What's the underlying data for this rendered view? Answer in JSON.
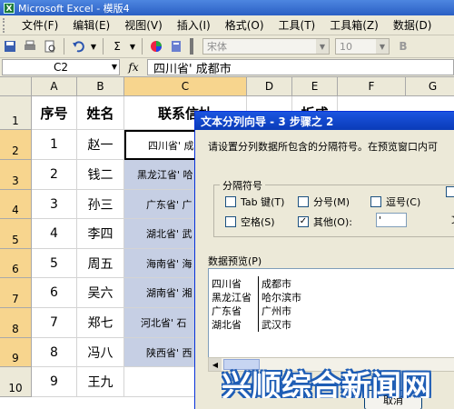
{
  "window": {
    "title": "Microsoft Excel - 模版4"
  },
  "menu": [
    {
      "label": "文件(F)"
    },
    {
      "label": "编辑(E)"
    },
    {
      "label": "视图(V)"
    },
    {
      "label": "插入(I)"
    },
    {
      "label": "格式(O)"
    },
    {
      "label": "工具(T)"
    },
    {
      "label": "工具箱(Z)"
    },
    {
      "label": "数据(D)"
    }
  ],
  "toolbar": {
    "font_name": "宋体",
    "font_size": "10",
    "sigma": "Σ"
  },
  "formula_bar": {
    "cell_ref": "C2",
    "fx": "fx",
    "content": "四川省' 成都市"
  },
  "columns": [
    "A",
    "B",
    "C",
    "D",
    "E",
    "F",
    "G"
  ],
  "rows": [
    "1",
    "2",
    "3",
    "4",
    "5",
    "6",
    "7",
    "8",
    "9",
    "10"
  ],
  "table": {
    "headers": [
      "序号",
      "姓名",
      "联系信址",
      "",
      "折成"
    ],
    "data": [
      {
        "no": "1",
        "name": "赵一",
        "addr": "四川省' 成"
      },
      {
        "no": "2",
        "name": "钱二",
        "addr": "黑龙江省' 哈"
      },
      {
        "no": "3",
        "name": "孙三",
        "addr": "广东省' 广"
      },
      {
        "no": "4",
        "name": "李四",
        "addr": "湖北省' 武"
      },
      {
        "no": "5",
        "name": "周五",
        "addr": "海南省' 海"
      },
      {
        "no": "6",
        "name": "吴六",
        "addr": "湖南省' 湘"
      },
      {
        "no": "7",
        "name": "郑七",
        "addr": "河北省' 石"
      },
      {
        "no": "8",
        "name": "冯八",
        "addr": "陕西省' 西"
      },
      {
        "no": "9",
        "name": "王九",
        "addr": ""
      }
    ]
  },
  "dialog": {
    "title": "文本分列向导 - 3 步骤之 2",
    "instruction": "请设置分列数据所包含的分隔符号。在预览窗口内可",
    "separator_group": "分隔符号",
    "tab": "Tab 键(T)",
    "semicolon": "分号(M)",
    "comma": "逗号(C)",
    "space": "空格(S)",
    "other": "其他(O):",
    "other_value": "'",
    "check_mark": "✓",
    "right_fragment": "文",
    "preview_label": "数据预览(P)",
    "preview_rows": [
      {
        "c1": "四川省",
        "c2": "成都市"
      },
      {
        "c1": "黑龙江省",
        "c2": "哈尔滨市"
      },
      {
        "c1": "广东省",
        "c2": "广州市"
      },
      {
        "c1": "湖北省",
        "c2": "武汉市"
      }
    ],
    "cancel": "取消"
  },
  "watermark": "兴顺综合新闻网"
}
